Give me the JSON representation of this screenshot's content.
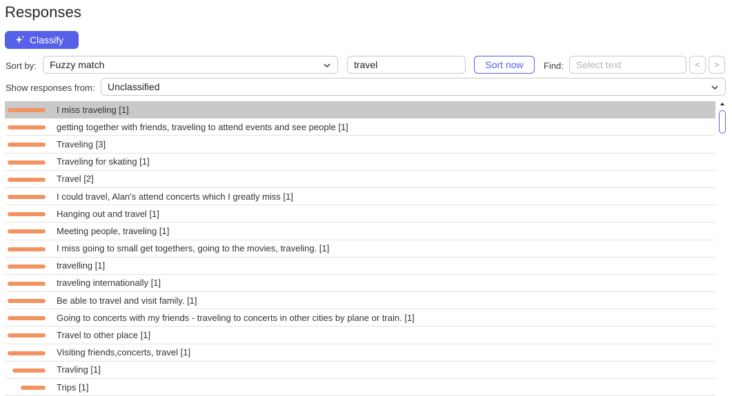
{
  "page": {
    "title": "Responses"
  },
  "toolbar": {
    "classify_label": "Classify",
    "sort_by_label": "Sort by:",
    "sort_by_value": "Fuzzy match",
    "search_value": "travel",
    "sort_now_label": "Sort now",
    "find_label": "Find:",
    "find_placeholder": "Select text",
    "prev_label": "<",
    "next_label": ">",
    "show_from_label": "Show responses from:",
    "show_from_value": "Unclassified"
  },
  "colors": {
    "accent": "#5660e8",
    "match_bar": "#f39361",
    "selected_row": "#c9c9c9"
  },
  "responses": [
    {
      "text": "I miss traveling [1]",
      "match": 1.0,
      "selected": true
    },
    {
      "text": "getting together with friends, traveling to attend events and see people [1]",
      "match": 1.0
    },
    {
      "text": "Traveling [3]",
      "match": 1.0
    },
    {
      "text": "Traveling for skating [1]",
      "match": 1.0
    },
    {
      "text": "Travel [2]",
      "match": 1.0
    },
    {
      "text": "I could travel, Alan's attend concerts which I greatly miss [1]",
      "match": 1.0
    },
    {
      "text": "Hanging out and travel [1]",
      "match": 1.0
    },
    {
      "text": "Meeting people, traveling [1]",
      "match": 1.0
    },
    {
      "text": "I miss going to small get togethers, going to the movies, traveling. [1]",
      "match": 1.0
    },
    {
      "text": "travelling [1]",
      "match": 1.0
    },
    {
      "text": "traveling internationally [1]",
      "match": 1.0
    },
    {
      "text": "Be able to travel and visit family. [1]",
      "match": 1.0
    },
    {
      "text": "Going to concerts with my friends - traveling to concerts in other cities by plane or train. [1]",
      "match": 1.0
    },
    {
      "text": "Travel to other place [1]",
      "match": 1.0
    },
    {
      "text": "Visiting friends,concerts, travel [1]",
      "match": 1.0
    },
    {
      "text": "Travling [1]",
      "match": 0.87
    },
    {
      "text": "Trips [1]",
      "match": 0.65
    }
  ]
}
